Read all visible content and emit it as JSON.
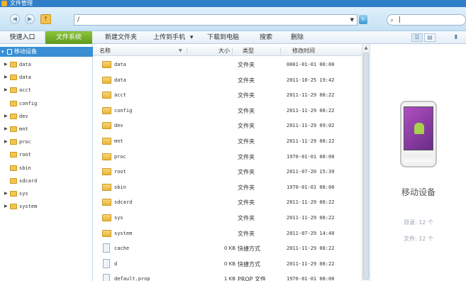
{
  "window": {
    "title": "文件管理"
  },
  "toolbar": {
    "back_icon": "back-arrow-icon",
    "forward_icon": "forward-arrow-icon",
    "up_icon": "folder-up-icon",
    "path_value": "/",
    "go_icon": "refresh-icon",
    "search_value": "|",
    "search_icon": "magnifier-icon"
  },
  "tabs": {
    "quick_access": "快速入口",
    "file_system": "文件系统"
  },
  "actions": {
    "new_folder": "新建文件夹",
    "upload": "上传到手机",
    "upload_arrow": "▾",
    "download": "下载到电脑",
    "search": "搜索",
    "delete": "删除"
  },
  "tree": {
    "root_label": "移动设备",
    "nodes": [
      {
        "label": "data",
        "expandable": true
      },
      {
        "label": "data",
        "expandable": true
      },
      {
        "label": "acct",
        "expandable": true
      },
      {
        "label": "config",
        "expandable": false
      },
      {
        "label": "dev",
        "expandable": true
      },
      {
        "label": "mnt",
        "expandable": true
      },
      {
        "label": "proc",
        "expandable": true
      },
      {
        "label": "root",
        "expandable": false
      },
      {
        "label": "sbin",
        "expandable": false
      },
      {
        "label": "sdcard",
        "expandable": false
      },
      {
        "label": "sys",
        "expandable": true
      },
      {
        "label": "system",
        "expandable": true
      }
    ]
  },
  "filelist": {
    "columns": {
      "name": "名称",
      "size": "大小",
      "type": "类型",
      "time": "修改时间"
    },
    "rows": [
      {
        "name": "data",
        "size": "",
        "type": "文件夹",
        "time": "0001-01-01 00:00",
        "kind": "folder"
      },
      {
        "name": "data",
        "size": "",
        "type": "文件夹",
        "time": "2011-10-25 19:42",
        "kind": "folder"
      },
      {
        "name": "acct",
        "size": "",
        "type": "文件夹",
        "time": "2011-11-29 08:22",
        "kind": "folder"
      },
      {
        "name": "config",
        "size": "",
        "type": "文件夹",
        "time": "2011-11-29 08:22",
        "kind": "folder"
      },
      {
        "name": "dev",
        "size": "",
        "type": "文件夹",
        "time": "2011-11-29 09:02",
        "kind": "folder"
      },
      {
        "name": "mnt",
        "size": "",
        "type": "文件夹",
        "time": "2011-11-29 08:22",
        "kind": "folder"
      },
      {
        "name": "proc",
        "size": "",
        "type": "文件夹",
        "time": "1970-01-01 08:00",
        "kind": "folder"
      },
      {
        "name": "root",
        "size": "",
        "type": "文件夹",
        "time": "2011-07-20 15:39",
        "kind": "folder"
      },
      {
        "name": "sbin",
        "size": "",
        "type": "文件夹",
        "time": "1970-01-01 08:00",
        "kind": "folder"
      },
      {
        "name": "sdcard",
        "size": "",
        "type": "文件夹",
        "time": "2011-11-29 08:22",
        "kind": "folder"
      },
      {
        "name": "sys",
        "size": "",
        "type": "文件夹",
        "time": "2011-11-29 08:22",
        "kind": "folder"
      },
      {
        "name": "system",
        "size": "",
        "type": "文件夹",
        "time": "2011-07-29 14:40",
        "kind": "folder"
      },
      {
        "name": "cache",
        "size": "0 KB",
        "type": "快捷方式",
        "time": "2011-11-29 08:22",
        "kind": "file"
      },
      {
        "name": "d",
        "size": "0 KB",
        "type": "快捷方式",
        "time": "2011-11-29 08:22",
        "kind": "file"
      },
      {
        "name": "default.prop",
        "size": "1 KB",
        "type": "PROP 文件",
        "time": "1970-01-01 08:00",
        "kind": "file"
      }
    ]
  },
  "device": {
    "name": "移动设备",
    "directories": "目录: 12 个",
    "files": "文件: 12 个"
  }
}
